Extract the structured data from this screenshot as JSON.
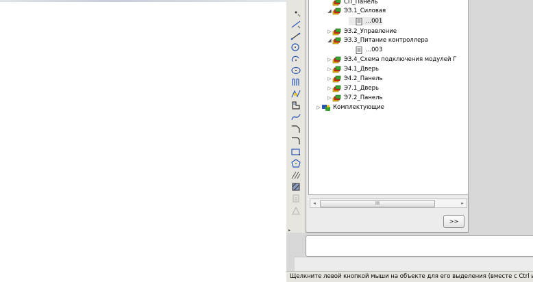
{
  "tree": {
    "items": [
      {
        "label": "СП_Панель",
        "icon": "stack-icon",
        "expander": ""
      },
      {
        "label": "ЭЗ.1_Силовая",
        "icon": "stack-icon",
        "expander": "◢"
      },
      {
        "label": "...001",
        "icon": "sheet-icon",
        "expander": "",
        "selected": true
      },
      {
        "label": "ЭЗ.2_Управление",
        "icon": "stack-icon",
        "expander": "▷"
      },
      {
        "label": "ЭЗ.3_Питание контроллера",
        "icon": "stack-icon",
        "expander": "◢"
      },
      {
        "label": "...003",
        "icon": "sheet-icon",
        "expander": ""
      },
      {
        "label": "ЭЗ.4_Схема подключения модулей Г",
        "icon": "stack-icon",
        "expander": "▷"
      },
      {
        "label": "Э4.1_Дверь",
        "icon": "stack-icon",
        "expander": "▷"
      },
      {
        "label": "Э4.2_Панель",
        "icon": "stack-icon",
        "expander": "▷"
      },
      {
        "label": "Э7.1_Дверь",
        "icon": "stack-icon",
        "expander": "▷"
      },
      {
        "label": "Э7.2_Панель",
        "icon": "stack-icon",
        "expander": "▷"
      },
      {
        "label": "Комплектующие",
        "icon": "components-icon",
        "expander": "▷"
      }
    ]
  },
  "scrollbar": {
    "left_arrow": "◂",
    "right_arrow": "▸",
    "grip": "III"
  },
  "buttons": {
    "more": ">>"
  },
  "status": {
    "text": "Щелкните левой кнопкой мыши на объекте для его выделения (вместе с Ctrl или"
  },
  "colors": {
    "accent_red": "#e0261b",
    "accent_green": "#39a52e",
    "accent_yellow": "#f0c419",
    "accent_blue": "#2a58b8"
  }
}
